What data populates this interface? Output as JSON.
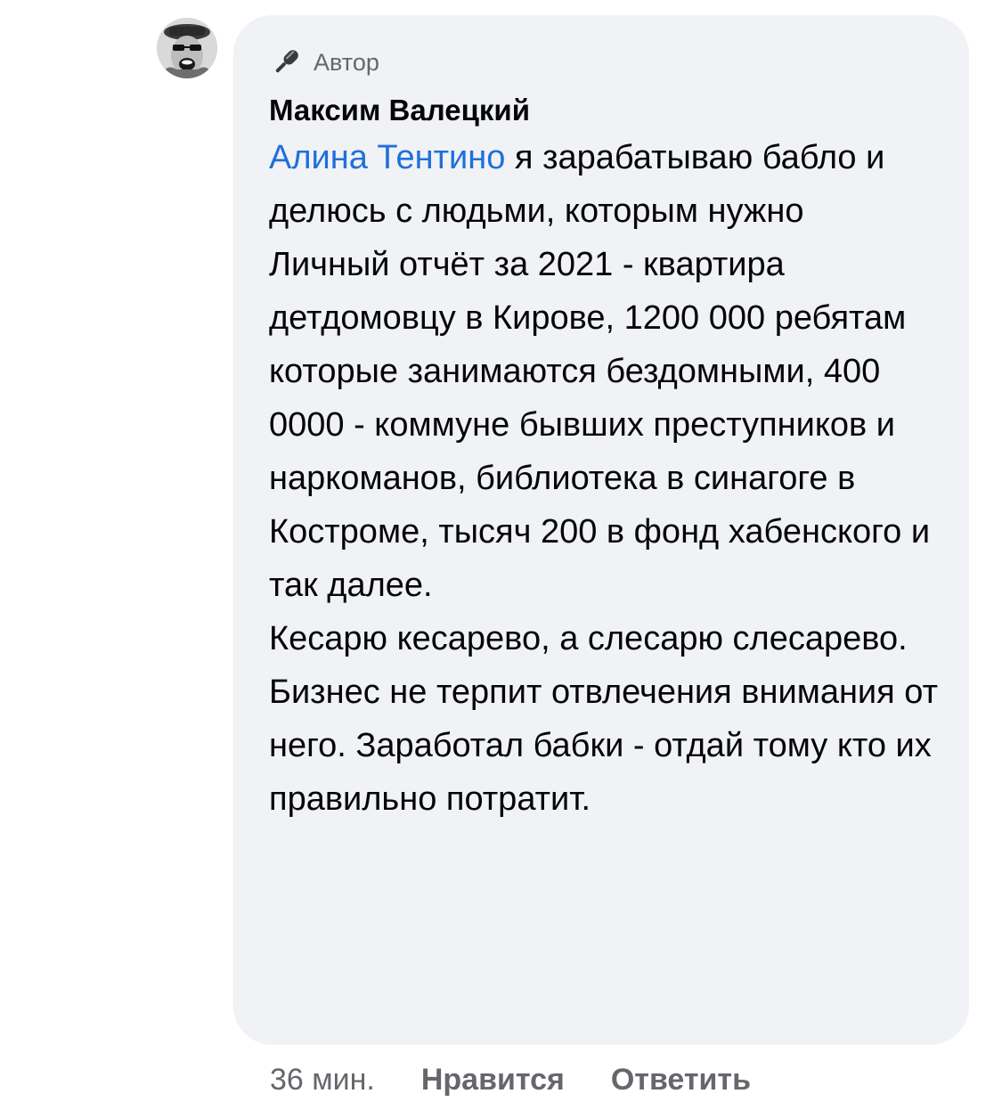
{
  "comment": {
    "badge": {
      "icon": "microphone-icon",
      "label": "Автор"
    },
    "author": "Максим Валецкий",
    "mention": "Алина Тентино",
    "text": " я зарабатываю бабло и делюсь с людьми, которым нужно\nЛичный отчёт за 2021 - квартира детдомовцу в Кирове, 1200 000 ребятам которые занимаются бездомными, 400 0000 - коммуне бывших преступников и наркоманов, библиотека в синагоге в Костроме, тысяч 200 в фонд хабенского и так далее.\nКесарю кесарево, а слесарю слесарево.\nБизнес не терпит отвлечения внимания от него. Заработал бабки - отдай тому кто их правильно потратит.",
    "colors": {
      "bubble_background": "#f0f2f5",
      "mention": "#216fdb",
      "secondary_text": "#65676b"
    }
  },
  "actions": {
    "time": "36 мин.",
    "like": "Нравится",
    "reply": "Ответить"
  }
}
